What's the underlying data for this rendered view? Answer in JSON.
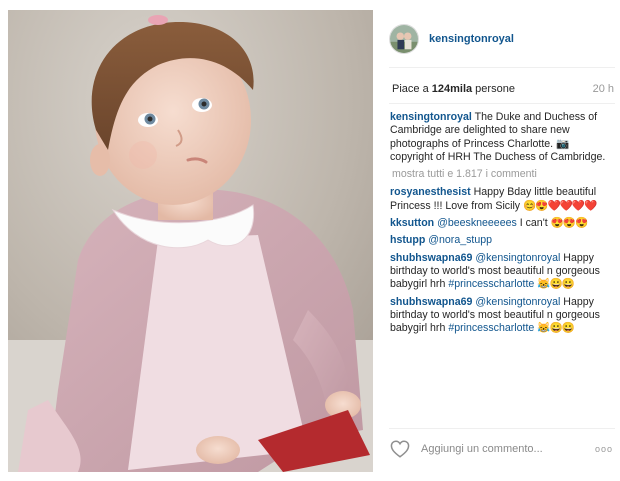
{
  "post": {
    "username": "kensingtonroyal",
    "likes_prefix": "Piace a ",
    "likes_count": "124mila",
    "likes_suffix": " persone",
    "age": "20 h",
    "caption_user": "kensingtonroyal",
    "caption_text": "The Duke and Duchess of Cambridge are delighted to share new photographs of Princess Charlotte. 📷 copyright of HRH The Duchess of Cambridge.",
    "more_comments": "mostra tutti e 1.817 i commenti"
  },
  "comments": [
    {
      "user": "rosyanesthesist",
      "mention": "",
      "text": "Happy Bday little beautiful Princess !!! Love from Sicily",
      "emoji": "😊😍❤️❤️❤️❤️",
      "tag": ""
    },
    {
      "user": "kksutton",
      "mention": "@beeskneeeees",
      "text": "I can't",
      "emoji": "😍😍😍",
      "tag": ""
    },
    {
      "user": "hstupp",
      "mention": "@nora_stupp",
      "text": "",
      "emoji": "",
      "tag": ""
    },
    {
      "user": "shubhswapna69",
      "mention": "@kensingtonroyal",
      "text": "Happy birthday to world's most beautiful n gorgeous babygirl hrh",
      "emoji": "😹😀😀",
      "tag": "#princesscharlotte"
    },
    {
      "user": "shubhswapna69",
      "mention": "@kensingtonroyal",
      "text": "Happy birthday to world's most beautiful n gorgeous babygirl hrh",
      "emoji": "😹😀😀",
      "tag": "#princesscharlotte"
    }
  ],
  "footer": {
    "placeholder": "Aggiungi un commento...",
    "options": "ooo"
  },
  "icons": {
    "heart": "heart-icon",
    "options": "more-options-icon"
  },
  "colors": {
    "link": "#12568e",
    "muted": "#999999"
  }
}
